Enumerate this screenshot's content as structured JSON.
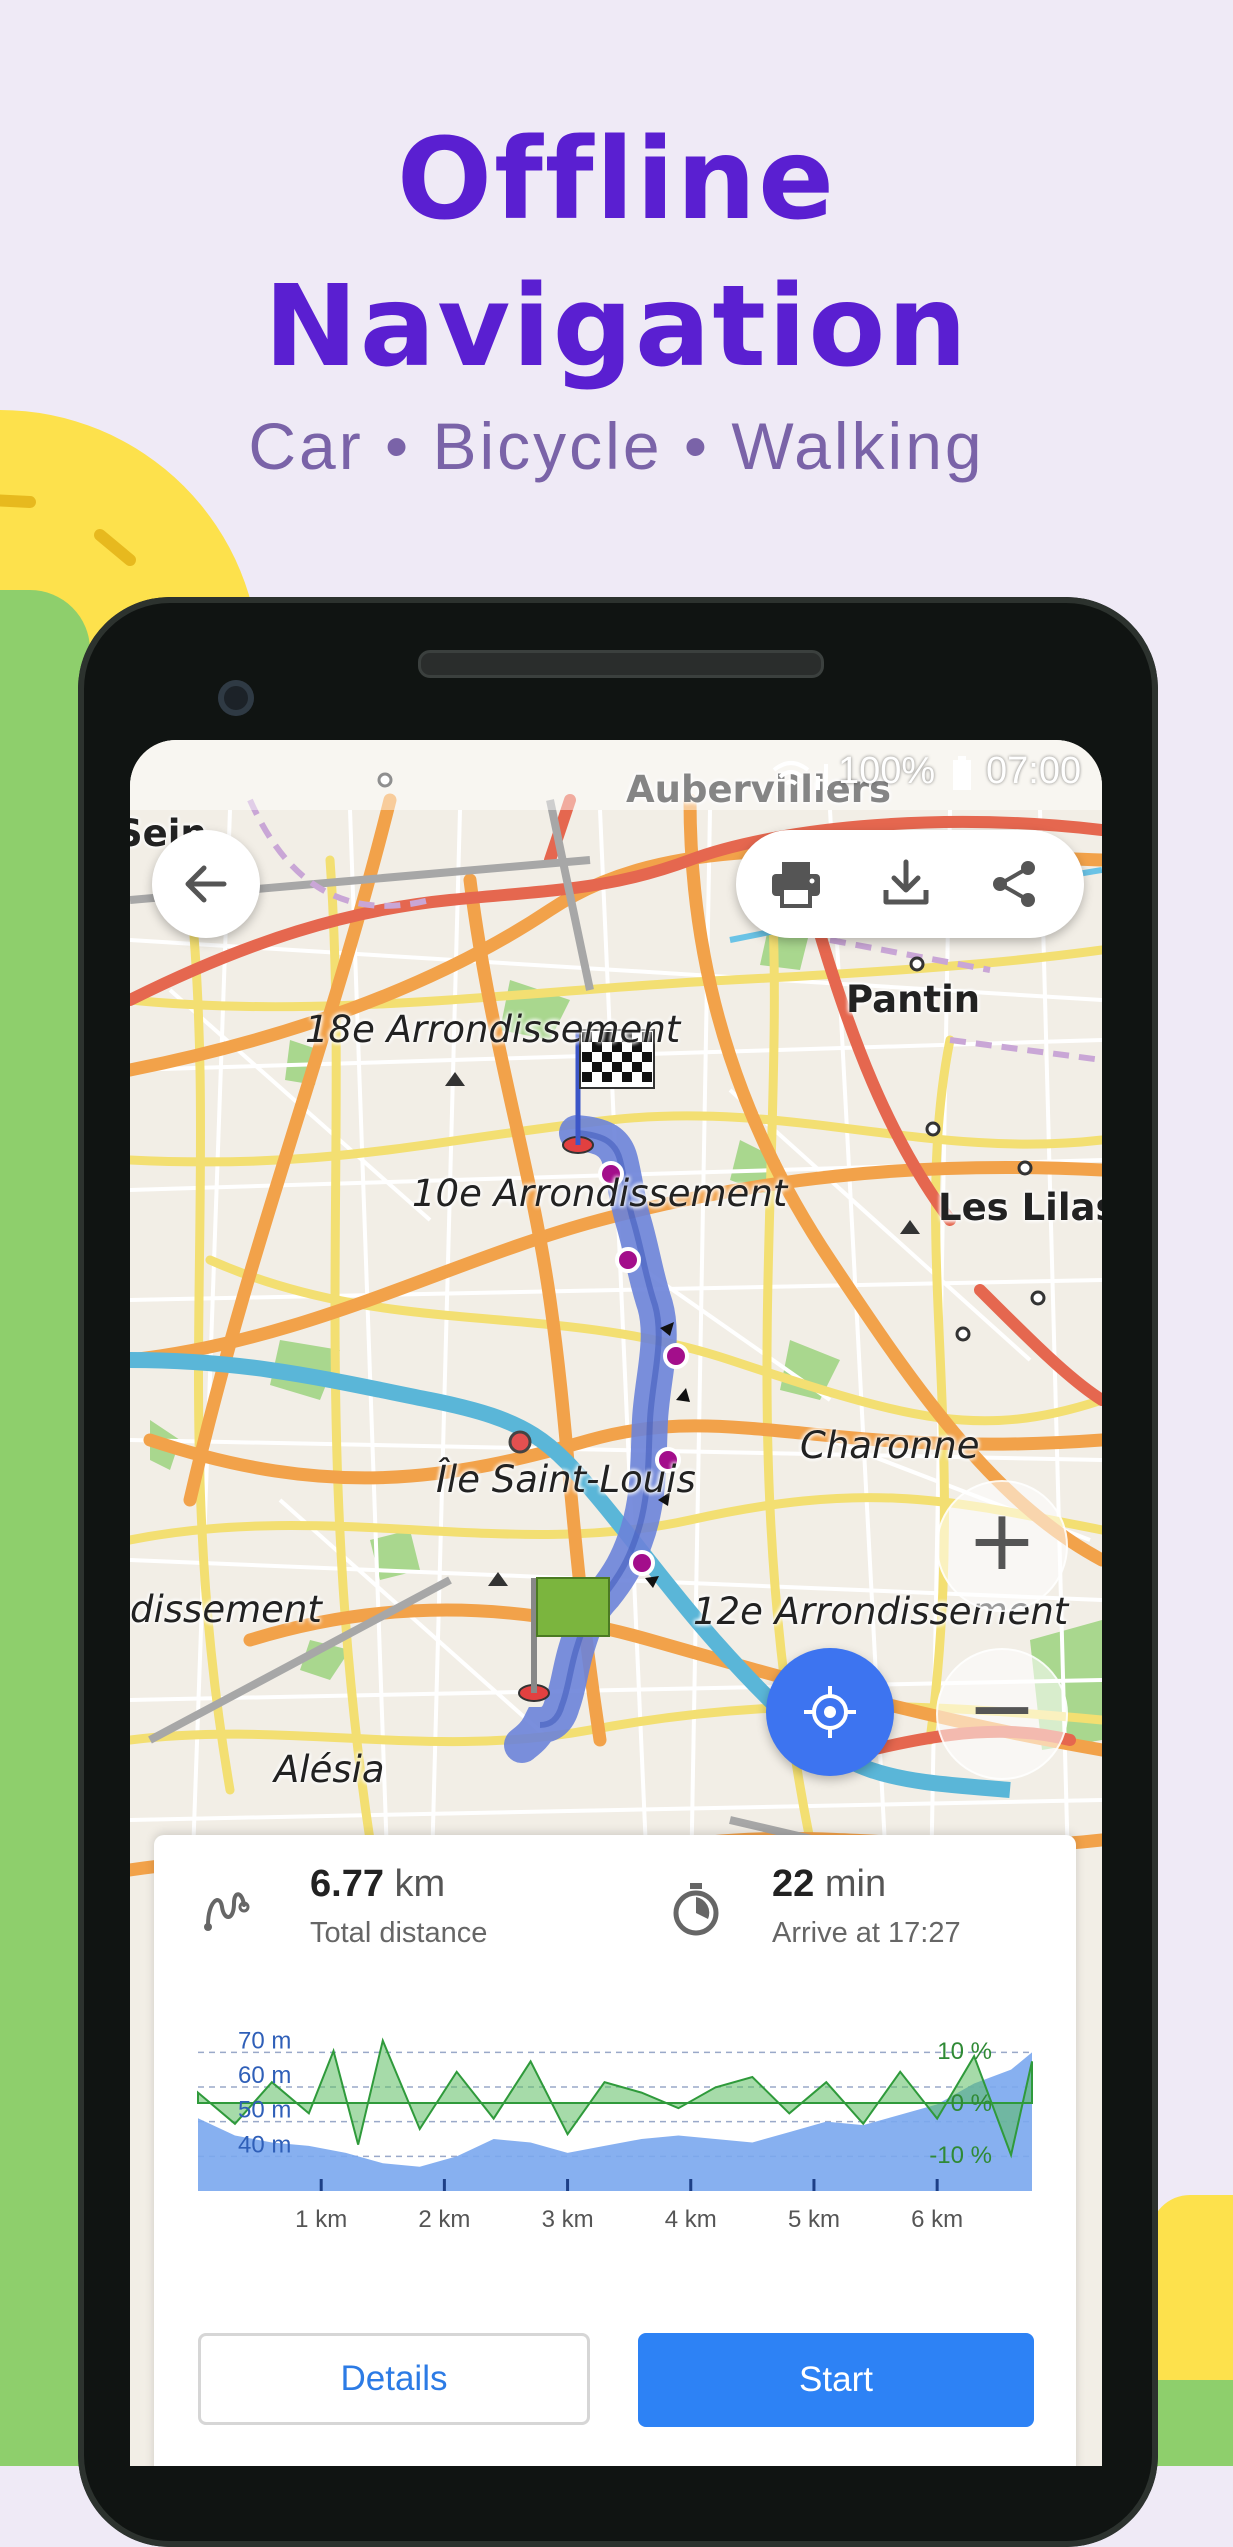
{
  "hero": {
    "title_line1": "Offline",
    "title_line2": "Navigation",
    "subtitle": "Car • Bicycle • Walking"
  },
  "status_bar": {
    "text": "100% ▮ 07:00",
    "battery": "100%",
    "time": "07:00",
    "icons": [
      "wifi-icon",
      "signal-icon",
      "battery-icon"
    ]
  },
  "toolbar": {
    "back_icon": "arrow-left-icon",
    "actions": [
      "print-icon",
      "download-icon",
      "share-icon"
    ]
  },
  "map": {
    "labels": [
      "Aubervilliers",
      "Pantin",
      "18e Arrondissement",
      "10e Arrondissement",
      "Les Lilas",
      "Charonne",
      "Île Saint-Louis",
      "12e Arrondissement",
      "dissement",
      "Alésia",
      "Sein"
    ]
  },
  "map_controls": {
    "zoom_in": "+",
    "zoom_out": "−",
    "locate_icon": "crosshair-icon"
  },
  "route_card": {
    "distance_value": "6.77",
    "distance_unit": "km",
    "distance_label": "Total distance",
    "time_value": "22",
    "time_unit": "min",
    "time_label": "Arrive at 17:27",
    "details_button": "Details",
    "start_button": "Start"
  },
  "chart_data": {
    "type": "area",
    "title": "",
    "y_left_ticks": [
      "70 m",
      "60 m",
      "50 m",
      "40 m"
    ],
    "y_right_ticks": [
      "10 %",
      "0 %",
      "-10 %"
    ],
    "x_ticks": [
      "1 km",
      "2 km",
      "3 km",
      "4 km",
      "5 km",
      "6 km"
    ],
    "xlim": [
      0,
      6.77
    ],
    "ylim": [
      30,
      75
    ],
    "series": [
      {
        "name": "",
        "color": "#7aa7ee",
        "x": [
          0,
          0.3,
          0.6,
          0.9,
          1.2,
          1.5,
          1.8,
          2.1,
          2.4,
          2.7,
          3.0,
          3.3,
          3.6,
          3.9,
          4.2,
          4.5,
          4.8,
          5.1,
          5.4,
          5.7,
          6.0,
          6.3,
          6.6,
          6.77
        ],
        "values": [
          51,
          46,
          44,
          43,
          41,
          38,
          37,
          40,
          45,
          44,
          41,
          43,
          45,
          46,
          45,
          44,
          47,
          50,
          49,
          52,
          55,
          61,
          65,
          70
        ]
      }
    ],
    "grade_series": {
      "name": "",
      "color": "#3fae4a",
      "x": [
        0,
        0.3,
        0.6,
        0.9,
        1.1,
        1.3,
        1.5,
        1.8,
        2.1,
        2.4,
        2.7,
        3.0,
        3.3,
        3.6,
        3.9,
        4.2,
        4.5,
        4.8,
        5.1,
        5.4,
        5.7,
        6.0,
        6.3,
        6.6,
        6.77
      ],
      "values": [
        2,
        -4,
        4,
        -2,
        10,
        -8,
        12,
        -5,
        6,
        -3,
        8,
        -6,
        4,
        2,
        -1,
        3,
        5,
        -2,
        4,
        -4,
        6,
        -3,
        9,
        -10,
        8
      ]
    }
  },
  "colors": {
    "accent": "#5a1fd1",
    "route": "#6b83d9",
    "button_primary": "#2d82f5"
  }
}
